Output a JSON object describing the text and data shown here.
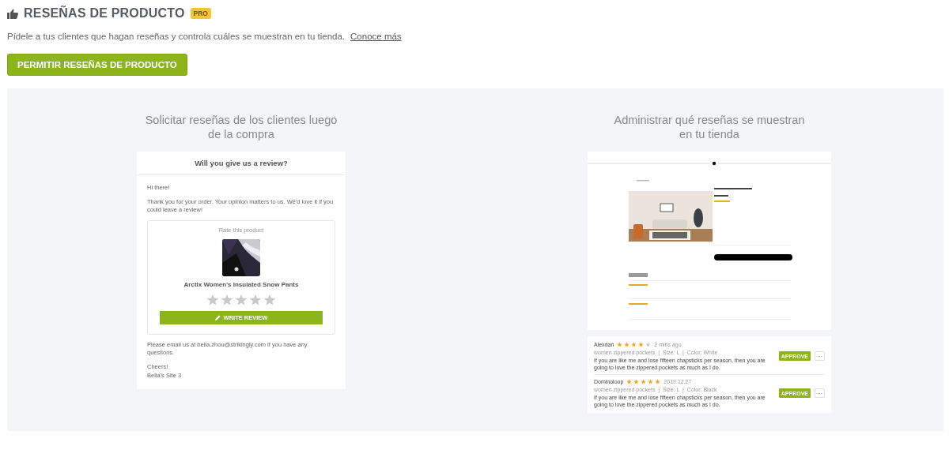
{
  "header": {
    "title": "RESEÑAS DE PRODUCTO",
    "badge": "PRO",
    "description": "Pídele a tus clientes que hagan reseñas y controla cuáles se muestran en tu tienda.",
    "link": "Conoce más",
    "button": "PERMITIR RESEÑAS DE PRODUCTO"
  },
  "left": {
    "caption": "Solicitar reseñas de los clientes luego de la compra",
    "email": {
      "title": "Will you give us a review?",
      "greeting": "Hi there!",
      "body": "Thank you for your order. Your opinion matters to us. We'd love it if you could leave a review!",
      "rate_label": "Rate this product",
      "product_name": "Arctix Women's Insulated Snow Pants",
      "stars": 0,
      "button": "WRITE REVIEW",
      "footer": "Please email us at bella.zhou@strikingly.com if you have any questions.",
      "signoff": "Cheers!",
      "signature": "Bella's Site 3"
    }
  },
  "right": {
    "caption": "Administrar qué reseñas se muestran en tu tienda",
    "admin_reviews": [
      {
        "name": "Alexdan",
        "stars": 4,
        "time": "2 mins ago",
        "details": "women zippered pockets  |  Size: L  |  Color: White",
        "text": "If you are like me and lose fifteen chapsticks per season, then you are going to love the zippered pockets as much as I do.",
        "button": "APPROVE",
        "more": "···"
      },
      {
        "name": "Dominoloop",
        "stars": 5,
        "time": "2019.12.27",
        "details": "women zippered pockets  |  Size: L  |  Color: Black",
        "text": "If you are like me and lose fifteen chapsticks per season, then you are going to love the zippered pockets as much as I do.",
        "button": "APPROVE",
        "more": "···"
      }
    ]
  }
}
